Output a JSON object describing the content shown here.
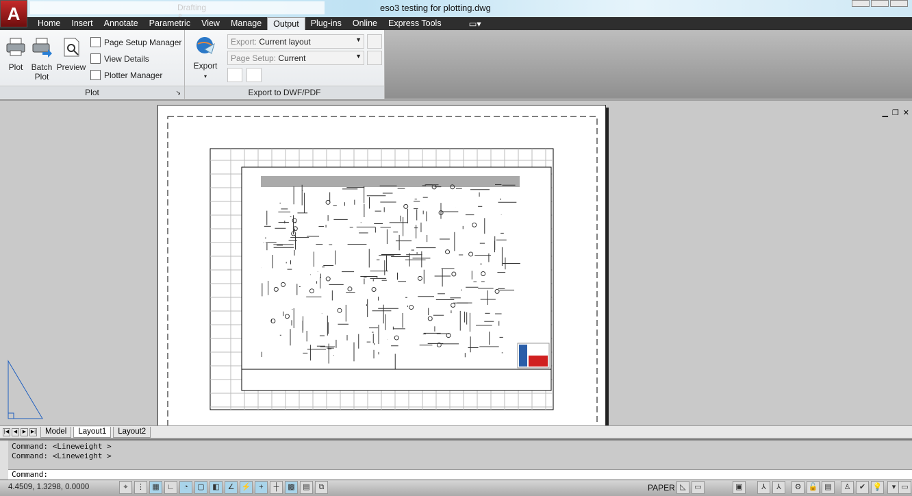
{
  "app": {
    "title": "eso3 testing for plotting.dwg",
    "workspace": "Drafting & A...",
    "logo": "A"
  },
  "ribbon_tabs": [
    "Home",
    "Insert",
    "Annotate",
    "Parametric",
    "View",
    "Manage",
    "Output",
    "Plug-ins",
    "Online",
    "Express Tools"
  ],
  "active_tab": "Output",
  "plot_panel": {
    "title": "Plot",
    "plot": "Plot",
    "batch_plot": [
      "Batch",
      "Plot"
    ],
    "preview": "Preview",
    "page_setup_manager": "Page Setup Manager",
    "view_details": "View Details",
    "plotter_manager": "Plotter Manager"
  },
  "export_panel": {
    "title": "Export to DWF/PDF",
    "export": "Export",
    "export_combo": {
      "key": "Export:",
      "value": "Current layout"
    },
    "page_setup_combo": {
      "key": "Page Setup:",
      "value": "Current"
    }
  },
  "layout_tabs": [
    "Model",
    "Layout1",
    "Layout2"
  ],
  "active_layout": "Layout1",
  "command": {
    "history": [
      "Command:  <Lineweight >",
      "Command:  <Lineweight >"
    ],
    "prompt": "Command:"
  },
  "status": {
    "coords": "4.4509, 1.3298, 0.0000",
    "space": "PAPER"
  },
  "colors": {
    "tabbar": "#2e2e2e",
    "accent_red": "#b01c1c",
    "status_on": "#a9d4ea"
  }
}
